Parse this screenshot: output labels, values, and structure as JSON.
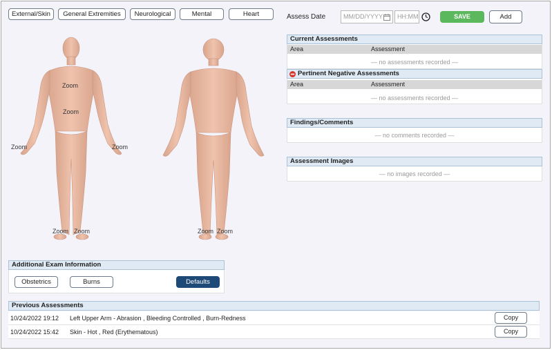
{
  "top_tabs": [
    "External/Skin",
    "General Extremities",
    "Neurological",
    "Mental",
    "Heart"
  ],
  "assess": {
    "label": "Assess Date",
    "date_placeholder": "MM/DD/YYYY",
    "time_placeholder": "HH:MM",
    "save_label": "SAVE",
    "add_label": "Add"
  },
  "body": {
    "zoom_label": "Zoom"
  },
  "current_assessments": {
    "title": "Current Assessments",
    "col_area": "Area",
    "col_assessment": "Assessment",
    "empty": "— no assessments recorded —"
  },
  "pertinent_negative": {
    "title": "Pertinent Negative Assessments",
    "col_area": "Area",
    "col_assessment": "Assessment",
    "empty": "— no assessments recorded —"
  },
  "findings": {
    "title": "Findings/Comments",
    "empty": "— no comments recorded —"
  },
  "images": {
    "title": "Assessment Images",
    "empty": "— no images recorded —"
  },
  "additional_exam": {
    "title": "Additional Exam Information",
    "obstetrics_label": "Obstetrics",
    "burns_label": "Burns",
    "defaults_label": "Defaults"
  },
  "previous": {
    "title": "Previous Assessments",
    "copy_label": "Copy",
    "rows": [
      {
        "datetime": "10/24/2022 19:12",
        "desc": "Left Upper Arm - Abrasion , Bleeding Controlled , Burn-Redness"
      },
      {
        "datetime": "10/24/2022 15:42",
        "desc": "Skin - Hot , Red (Erythematous)"
      }
    ]
  },
  "colors": {
    "accent_green": "#5cb85c",
    "accent_navy": "#1e4a78",
    "header_blue": "#dfeaf4",
    "skin": "#e7b8a2",
    "negative_red": "#d9342b"
  }
}
